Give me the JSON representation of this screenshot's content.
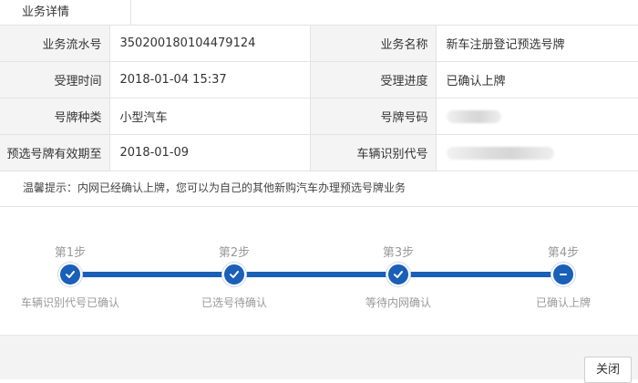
{
  "tab": {
    "label": "业务详情"
  },
  "details": {
    "rows": [
      {
        "l1": "业务流水号",
        "v1": "350200180104479124",
        "l2": "业务名称",
        "v2": "新车注册登记预选号牌"
      },
      {
        "l1": "受理时间",
        "v1": "2018-01-04 15:37",
        "l2": "受理进度",
        "v2": "已确认上牌"
      },
      {
        "l1": "号牌种类",
        "v1": "小型汽车",
        "l2": "号牌号码",
        "v2": ""
      },
      {
        "l1": "预选号牌有效期至",
        "v1": "2018-01-09",
        "l2": "车辆识别代号",
        "v2": ""
      }
    ]
  },
  "tip": {
    "text": "温馨提示：内网已经确认上牌，您可以为自己的其他新购汽车办理预选号牌业务"
  },
  "steps": [
    {
      "num": "第1步",
      "label": "车辆识别代号已确认",
      "state": "done"
    },
    {
      "num": "第2步",
      "label": "已选号待确认",
      "state": "done"
    },
    {
      "num": "第3步",
      "label": "等待内网确认",
      "state": "done"
    },
    {
      "num": "第4步",
      "label": "已确认上牌",
      "state": "current"
    }
  ],
  "footer": {
    "close_label": "关闭"
  },
  "colors": {
    "accent": "#1a5fb8",
    "label_bg": "#f4f4f4"
  }
}
